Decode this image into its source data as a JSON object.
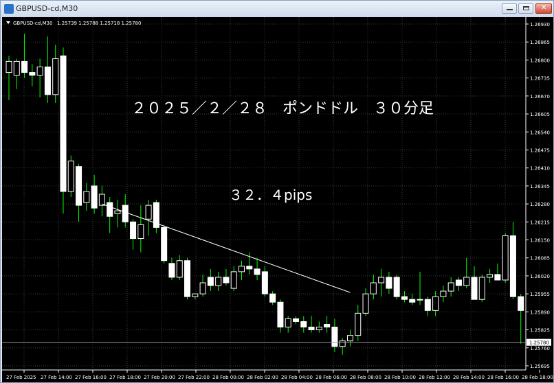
{
  "window": {
    "title": "GBPUSD-cd,M30"
  },
  "chart_header": {
    "symbol_tf": "GBPUSD-cd,M30",
    "ohlc": "1.25739 1.25788 1.25718 1.25780"
  },
  "annotations": {
    "title": "２０２５／２／２８　ポンドドル　３０分足",
    "pips": "３２．４pips"
  },
  "colors": {
    "background": "#000000",
    "grid": "#3a3a3a",
    "candle": "#ffffff",
    "wick": "#00ff00",
    "text": "#ffffff",
    "trendline": "#ffffff"
  },
  "current_price": {
    "label": "1.25780",
    "value": 1.2578
  },
  "chart_data": {
    "type": "candlestick",
    "y_axis": {
      "min": 1.2569,
      "max": 1.2693,
      "ticks": [
        {
          "v": 1.2693,
          "label": "1.26930"
        },
        {
          "v": 1.26865,
          "label": "1.26865"
        },
        {
          "v": 1.268,
          "label": "1.26800"
        },
        {
          "v": 1.26735,
          "label": "1.26735"
        },
        {
          "v": 1.2667,
          "label": "1.26670"
        },
        {
          "v": 1.26605,
          "label": "1.26605"
        },
        {
          "v": 1.2654,
          "label": "1.26540"
        },
        {
          "v": 1.26475,
          "label": "1.26475"
        },
        {
          "v": 1.2641,
          "label": "1.26410"
        },
        {
          "v": 1.26345,
          "label": "1.26345"
        },
        {
          "v": 1.2628,
          "label": "1.26280"
        },
        {
          "v": 1.26215,
          "label": "1.26215"
        },
        {
          "v": 1.2615,
          "label": "1.26150"
        },
        {
          "v": 1.26085,
          "label": "1.26085"
        },
        {
          "v": 1.2602,
          "label": "1.26020"
        },
        {
          "v": 1.25955,
          "label": "1.25955"
        },
        {
          "v": 1.2589,
          "label": "1.25890"
        },
        {
          "v": 1.25825,
          "label": "1.25825"
        },
        {
          "v": 1.2576,
          "label": "1.25760"
        },
        {
          "v": 1.25695,
          "label": "1.25695"
        }
      ]
    },
    "x_axis": {
      "labels": [
        "27 Feb 2025",
        "27 Feb 14:00",
        "27 Feb 16:00",
        "27 Feb 18:00",
        "27 Feb 20:00",
        "27 Feb 22:00",
        "28 Feb 00:00",
        "28 Feb 02:00",
        "28 Feb 04:00",
        "28 Feb 06:00",
        "28 Feb 08:00",
        "28 Feb 10:00",
        "28 Feb 12:00",
        "28 Feb 14:00",
        "28 Feb 16:00",
        "28 Feb 18:00"
      ]
    },
    "trendline": {
      "from": {
        "index": 12,
        "price": 1.2628
      },
      "to": {
        "index": 44,
        "price": 1.2596
      }
    },
    "candles": [
      {
        "o": 1.26755,
        "h": 1.26815,
        "l": 1.26655,
        "c": 1.26795
      },
      {
        "o": 1.26745,
        "h": 1.26805,
        "l": 1.26695,
        "c": 1.26795
      },
      {
        "o": 1.26795,
        "h": 1.26895,
        "l": 1.26735,
        "c": 1.26755
      },
      {
        "o": 1.26755,
        "h": 1.26785,
        "l": 1.26705,
        "c": 1.26745
      },
      {
        "o": 1.26745,
        "h": 1.26805,
        "l": 1.26665,
        "c": 1.26775
      },
      {
        "o": 1.26775,
        "h": 1.26885,
        "l": 1.26645,
        "c": 1.26675
      },
      {
        "o": 1.26675,
        "h": 1.26855,
        "l": 1.26645,
        "c": 1.26805
      },
      {
        "o": 1.26815,
        "h": 1.26845,
        "l": 1.26245,
        "c": 1.26325
      },
      {
        "o": 1.26325,
        "h": 1.26455,
        "l": 1.26305,
        "c": 1.26435
      },
      {
        "o": 1.26415,
        "h": 1.26425,
        "l": 1.26215,
        "c": 1.26275
      },
      {
        "o": 1.26285,
        "h": 1.26355,
        "l": 1.26255,
        "c": 1.26325
      },
      {
        "o": 1.26345,
        "h": 1.26385,
        "l": 1.26245,
        "c": 1.26265
      },
      {
        "o": 1.26275,
        "h": 1.26345,
        "l": 1.26235,
        "c": 1.26315
      },
      {
        "o": 1.26285,
        "h": 1.26305,
        "l": 1.26175,
        "c": 1.26235
      },
      {
        "o": 1.26245,
        "h": 1.26295,
        "l": 1.26195,
        "c": 1.26255
      },
      {
        "o": 1.26275,
        "h": 1.26315,
        "l": 1.26195,
        "c": 1.26215
      },
      {
        "o": 1.26215,
        "h": 1.26225,
        "l": 1.26115,
        "c": 1.26155
      },
      {
        "o": 1.26155,
        "h": 1.26275,
        "l": 1.26105,
        "c": 1.26205
      },
      {
        "o": 1.26225,
        "h": 1.26295,
        "l": 1.26165,
        "c": 1.26275
      },
      {
        "o": 1.26285,
        "h": 1.26295,
        "l": 1.26175,
        "c": 1.26195
      },
      {
        "o": 1.26195,
        "h": 1.26205,
        "l": 1.26065,
        "c": 1.26075
      },
      {
        "o": 1.26065,
        "h": 1.26085,
        "l": 1.26005,
        "c": 1.26015
      },
      {
        "o": 1.26015,
        "h": 1.26095,
        "l": 1.26005,
        "c": 1.26075
      },
      {
        "o": 1.26075,
        "h": 1.26085,
        "l": 1.25935,
        "c": 1.25945
      },
      {
        "o": 1.25945,
        "h": 1.25955,
        "l": 1.25935,
        "c": 1.25955
      },
      {
        "o": 1.25955,
        "h": 1.26025,
        "l": 1.25945,
        "c": 1.25995
      },
      {
        "o": 1.26015,
        "h": 1.26045,
        "l": 1.25965,
        "c": 1.25985
      },
      {
        "o": 1.25985,
        "h": 1.26035,
        "l": 1.25965,
        "c": 1.26015
      },
      {
        "o": 1.26015,
        "h": 1.26045,
        "l": 1.25985,
        "c": 1.25995
      },
      {
        "o": 1.25975,
        "h": 1.26055,
        "l": 1.25965,
        "c": 1.26035
      },
      {
        "o": 1.26035,
        "h": 1.26075,
        "l": 1.26005,
        "c": 1.26055
      },
      {
        "o": 1.26055,
        "h": 1.26105,
        "l": 1.26025,
        "c": 1.26045
      },
      {
        "o": 1.26045,
        "h": 1.26085,
        "l": 1.26005,
        "c": 1.26025
      },
      {
        "o": 1.26035,
        "h": 1.26055,
        "l": 1.25945,
        "c": 1.25955
      },
      {
        "o": 1.25955,
        "h": 1.25965,
        "l": 1.25915,
        "c": 1.25925
      },
      {
        "o": 1.25925,
        "h": 1.25935,
        "l": 1.25815,
        "c": 1.25835
      },
      {
        "o": 1.25835,
        "h": 1.25875,
        "l": 1.25815,
        "c": 1.25865
      },
      {
        "o": 1.25865,
        "h": 1.25875,
        "l": 1.25845,
        "c": 1.25855
      },
      {
        "o": 1.25855,
        "h": 1.25875,
        "l": 1.25815,
        "c": 1.25835
      },
      {
        "o": 1.25835,
        "h": 1.25875,
        "l": 1.25815,
        "c": 1.25825
      },
      {
        "o": 1.25825,
        "h": 1.25855,
        "l": 1.25815,
        "c": 1.25835
      },
      {
        "o": 1.25845,
        "h": 1.25875,
        "l": 1.25815,
        "c": 1.25835
      },
      {
        "o": 1.25835,
        "h": 1.25865,
        "l": 1.25745,
        "c": 1.25765
      },
      {
        "o": 1.25765,
        "h": 1.25795,
        "l": 1.25735,
        "c": 1.25785
      },
      {
        "o": 1.25785,
        "h": 1.25825,
        "l": 1.25765,
        "c": 1.25805
      },
      {
        "o": 1.25805,
        "h": 1.25915,
        "l": 1.25785,
        "c": 1.25885
      },
      {
        "o": 1.25885,
        "h": 1.25975,
        "l": 1.25875,
        "c": 1.25955
      },
      {
        "o": 1.25955,
        "h": 1.26025,
        "l": 1.25935,
        "c": 1.25995
      },
      {
        "o": 1.25995,
        "h": 1.26045,
        "l": 1.25945,
        "c": 1.26015
      },
      {
        "o": 1.26015,
        "h": 1.26035,
        "l": 1.25955,
        "c": 1.25975
      },
      {
        "o": 1.26015,
        "h": 1.26025,
        "l": 1.25935,
        "c": 1.25945
      },
      {
        "o": 1.25945,
        "h": 1.25965,
        "l": 1.25925,
        "c": 1.25935
      },
      {
        "o": 1.25935,
        "h": 1.25955,
        "l": 1.25915,
        "c": 1.25925
      },
      {
        "o": 1.25935,
        "h": 1.26035,
        "l": 1.25915,
        "c": 1.25935
      },
      {
        "o": 1.25935,
        "h": 1.25945,
        "l": 1.25875,
        "c": 1.25895
      },
      {
        "o": 1.25895,
        "h": 1.25965,
        "l": 1.25875,
        "c": 1.25945
      },
      {
        "o": 1.25945,
        "h": 1.25985,
        "l": 1.25925,
        "c": 1.25965
      },
      {
        "o": 1.25965,
        "h": 1.26015,
        "l": 1.25945,
        "c": 1.25995
      },
      {
        "o": 1.26005,
        "h": 1.26015,
        "l": 1.25965,
        "c": 1.25985
      },
      {
        "o": 1.25985,
        "h": 1.26085,
        "l": 1.25975,
        "c": 1.26015
      },
      {
        "o": 1.26015,
        "h": 1.26055,
        "l": 1.25975,
        "c": 1.25935
      },
      {
        "o": 1.25935,
        "h": 1.26025,
        "l": 1.25925,
        "c": 1.26015
      },
      {
        "o": 1.26015,
        "h": 1.26045,
        "l": 1.25995,
        "c": 1.26025
      },
      {
        "o": 1.26025,
        "h": 1.26065,
        "l": 1.26005,
        "c": 1.26005
      },
      {
        "o": 1.26005,
        "h": 1.26175,
        "l": 1.25995,
        "c": 1.26165
      },
      {
        "o": 1.26165,
        "h": 1.26215,
        "l": 1.25935,
        "c": 1.25945
      },
      {
        "o": 1.25945,
        "h": 1.25955,
        "l": 1.25775,
        "c": 1.25895
      }
    ]
  }
}
